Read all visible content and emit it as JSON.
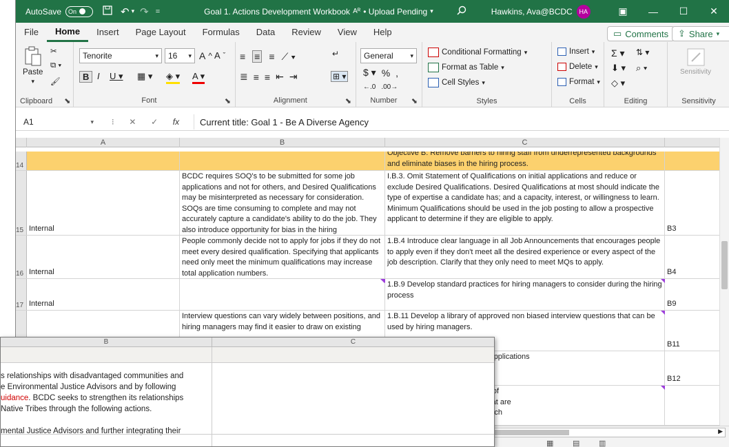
{
  "titlebar": {
    "autosave": "AutoSave",
    "toggle": "On",
    "doc_title": "Goal 1. Actions Development Workbook",
    "status": "• Upload Pending",
    "user": "Hawkins, Ava@BCDC",
    "initials": "HA"
  },
  "menu": {
    "tabs": [
      "File",
      "Home",
      "Insert",
      "Page Layout",
      "Formulas",
      "Data",
      "Review",
      "View",
      "Help"
    ],
    "comments": "Comments",
    "share": "Share"
  },
  "ribbon": {
    "paste": "Paste",
    "clipboard": "Clipboard",
    "font_name": "Tenorite",
    "font_size": "16",
    "font": "Font",
    "alignment": "Alignment",
    "number_format": "General",
    "number": "Number",
    "cond_format": "Conditional Formatting",
    "format_table": "Format as Table",
    "cell_styles": "Cell Styles",
    "styles": "Styles",
    "insert": "Insert",
    "delete": "Delete",
    "format": "Format",
    "cells": "Cells",
    "editing": "Editing",
    "sensitivity_btn": "Sensitivity",
    "sensitivity": "Sensitivity"
  },
  "formula_bar": {
    "name_box": "A1",
    "fx": "fx",
    "content": "Current title: Goal 1 - Be A Diverse Agency"
  },
  "columns": [
    "A",
    "B",
    "C"
  ],
  "rows": [
    {
      "num": "14",
      "a": "",
      "b": "",
      "c": "Objective B: Remove barriers to hiring staff from underrepresented backgrounds and eliminate biases in the hiring process.",
      "d": ""
    },
    {
      "num": "15",
      "a": "Internal",
      "b": "BCDC requires SOQ's to be submitted for some job applications and not for others, and Desired Qualifications may be misinterpreted as necessary for consideration. SOQs are time consuming to complete and may not accurately capture a candidate's ability to do the job. They also introduce opportunity for bias in the hiring",
      "c": "I.B.3. Omit Statement of Qualifications on initial applications and reduce or exclude Desired Qualifications. Desired Qualifications at most should indicate the type of expertise a candidate has; and a capacity, interest, or willingness to learn. Minimum Qualifications should be used in the job posting to allow a prospective applicant to determine if they are eligible to apply.",
      "d": "B3"
    },
    {
      "num": "16",
      "a": "Internal",
      "b": "People commonly decide not to apply for jobs if they do not meet every desired qualification. Specifying that applicants need only meet the minimum qualifications may increase total application numbers.",
      "c": "1.B.4 Introduce clear language in all Job Announcements that encourages people to apply even if they don't meet all the desired experience or every aspect of the job description. Clarify that they only need to meet MQs to apply.",
      "d": "B4"
    },
    {
      "num": "17",
      "a": "Internal",
      "b": "",
      "c": "1.B.9 Develop standard practices for hiring managers to consider during the hiring process",
      "d": "B9"
    },
    {
      "num": "",
      "a": "",
      "b": "Interview questions can vary widely between positions, and hiring managers may find it easier to draw on existing",
      "c": "1.B.11 Develop a library of approved non biased interview questions that can be used by hiring managers.",
      "d": "B11"
    },
    {
      "num": "",
      "a": "",
      "b": "",
      "c": "IHR to deliver fully blinded job applications\nnagers.",
      "d": "B12"
    },
    {
      "num": "",
      "a": "",
      "b": "",
      "c": "t of a metric for the percentage of\nC to promote interview pools that are\nhics to the extent feasible for each",
      "d": ""
    }
  ],
  "overlay": {
    "col_b": "B",
    "col_c": "C",
    "line1": "s relationships with disadvantaged communities and",
    "line2": "e Environmental Justice Advisors and by following",
    "line3a": "uidance",
    "line3b": ". BCDC seeks to strengthen its relationships",
    "line4": "Native Tribes through the following actions.",
    "line5": "mental Justice Advisors and further integrating their"
  },
  "colors": {
    "accent": "#217346",
    "objective_fill": "#fcd16e",
    "comment_flag": "#9d3fdb"
  }
}
